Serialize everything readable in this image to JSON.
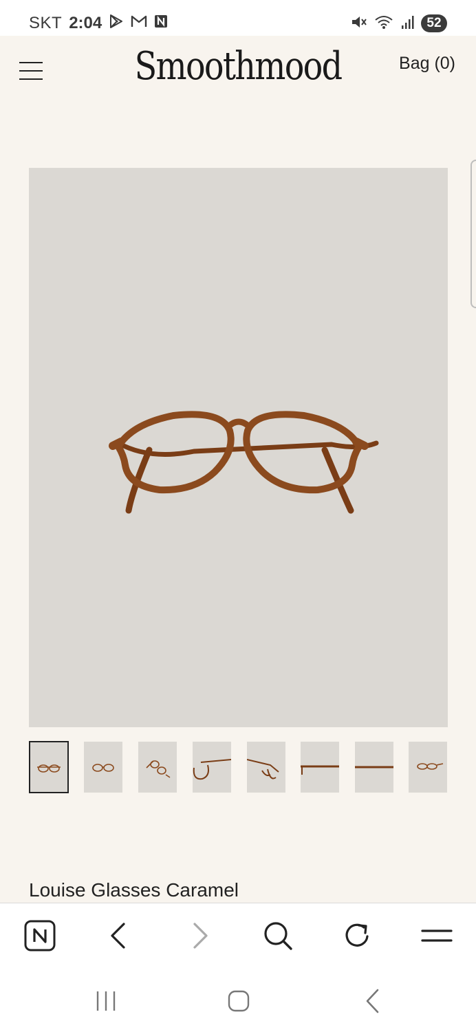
{
  "status_bar": {
    "carrier": "SKT",
    "time": "2:04",
    "notification_icons": [
      "play-store-icon",
      "gmail-icon",
      "naver-icon"
    ],
    "system_icons": [
      "mute-icon",
      "wifi-icon",
      "signal-icon"
    ],
    "battery": "52"
  },
  "header": {
    "logo": "Smoothmood",
    "bag_label": "Bag (0)",
    "menu_icon": "hamburger-menu-icon"
  },
  "product": {
    "title": "Louise Glasses Caramel",
    "frame_color": "#8b4a1e",
    "image_background": "#dbd8d3",
    "thumbnail_count": 8,
    "selected_thumbnail": 1
  },
  "browser_toolbar": {
    "icons": [
      "naver-icon",
      "back-icon",
      "forward-icon",
      "search-icon",
      "refresh-icon",
      "menu-icon"
    ]
  },
  "nav_bar": {
    "icons": [
      "recent-apps-icon",
      "home-icon",
      "back-icon"
    ]
  },
  "colors": {
    "page_background": "#f8f4ee",
    "text": "#222222",
    "frame": "#8b4a1e"
  }
}
